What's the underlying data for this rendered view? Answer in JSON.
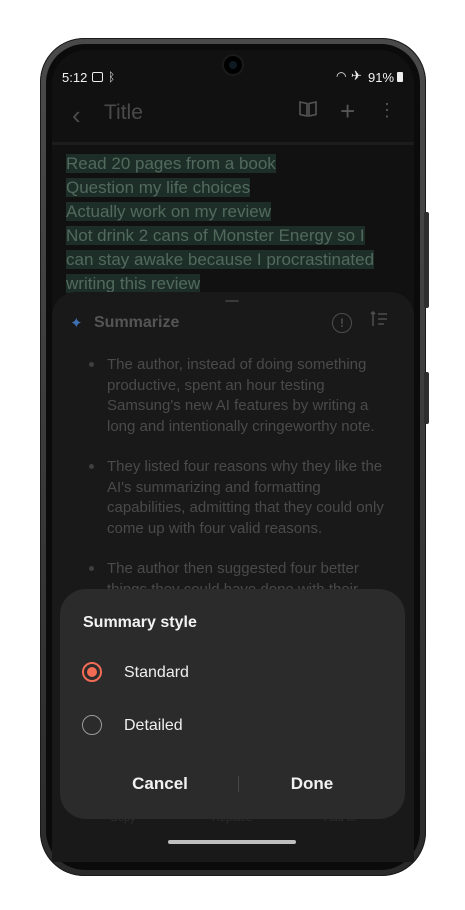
{
  "status_bar": {
    "time": "5:12",
    "battery": "91%"
  },
  "toolbar": {
    "title": "Title"
  },
  "note": {
    "lines": [
      "Read 20 pages from a book",
      "Question my life choices",
      "Actually work on my review",
      "Not drink 2 cans of Monster Energy so I",
      "can stay awake because I procrastinated",
      "writing this review"
    ]
  },
  "summarize": {
    "title": "Summarize",
    "bullets": [
      "The author, instead of doing something productive, spent an hour testing Samsung's new AI features by writing a long and intentionally cringeworthy note.",
      "They listed four reasons why they like the AI's summarizing and formatting capabilities, admitting that they could only come up with four valid reasons.",
      "The author then suggested four better things they could have done with their"
    ],
    "bottom_actions": [
      "Copy",
      "Replace",
      "Add to"
    ]
  },
  "dialog": {
    "title": "Summary style",
    "options": [
      {
        "label": "Standard",
        "selected": true
      },
      {
        "label": "Detailed",
        "selected": false
      }
    ],
    "cancel_label": "Cancel",
    "done_label": "Done"
  },
  "colors": {
    "accent": "#f26b55",
    "dialog_bg": "#2b2b2b",
    "highlight": "#1d2e28"
  },
  "icons": [
    "back-icon",
    "book-icon",
    "plus-icon",
    "more-icon",
    "sparkle-icon",
    "info-icon",
    "format-icon",
    "wifi-icon",
    "airplane-icon",
    "bluetooth-icon",
    "battery-icon"
  ]
}
